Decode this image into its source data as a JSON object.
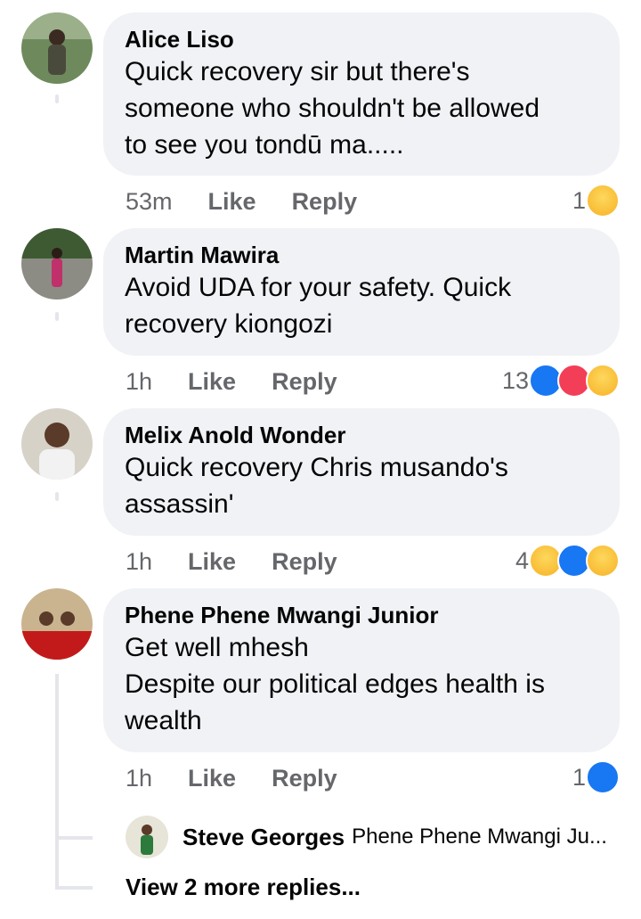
{
  "comments": [
    {
      "author": "Alice Liso",
      "text": "Quick recovery sir but there's\nsomeone who shouldn't be allowed\nto see you tondū ma.....",
      "time": "53m",
      "like": "Like",
      "reply": "Reply",
      "reaction_count": "1",
      "reactions": [
        "haha-icon"
      ]
    },
    {
      "author": "Martin Mawira",
      "text": "Avoid UDA for your safety. Quick\nrecovery kiongozi",
      "time": "1h",
      "like": "Like",
      "reply": "Reply",
      "reaction_count": "13",
      "reactions": [
        "like-icon",
        "love-icon",
        "haha-icon"
      ]
    },
    {
      "author": "Melix Anold Wonder",
      "text": "Quick recovery Chris musando's\nassassin'",
      "time": "1h",
      "like": "Like",
      "reply": "Reply",
      "reaction_count": "4",
      "reactions": [
        "haha-icon",
        "like-icon",
        "wow-icon"
      ]
    },
    {
      "author": "Phene Phene Mwangi Junior",
      "text": "Get well mhesh\nDespite our political edges health is\nwealth",
      "time": "1h",
      "like": "Like",
      "reply": "Reply",
      "reaction_count": "1",
      "reactions": [
        "like-icon"
      ]
    }
  ],
  "reply_preview": {
    "author": "Steve Georges",
    "text": "Phene Phene Mwangi Ju..."
  },
  "view_more": "View 2 more replies...",
  "colors": {
    "bubble": "#f0f2f5",
    "meta": "#65676b",
    "like_blue": "#1877f2",
    "love_red": "#f33e58",
    "haha_yellow": "#f7b125"
  }
}
